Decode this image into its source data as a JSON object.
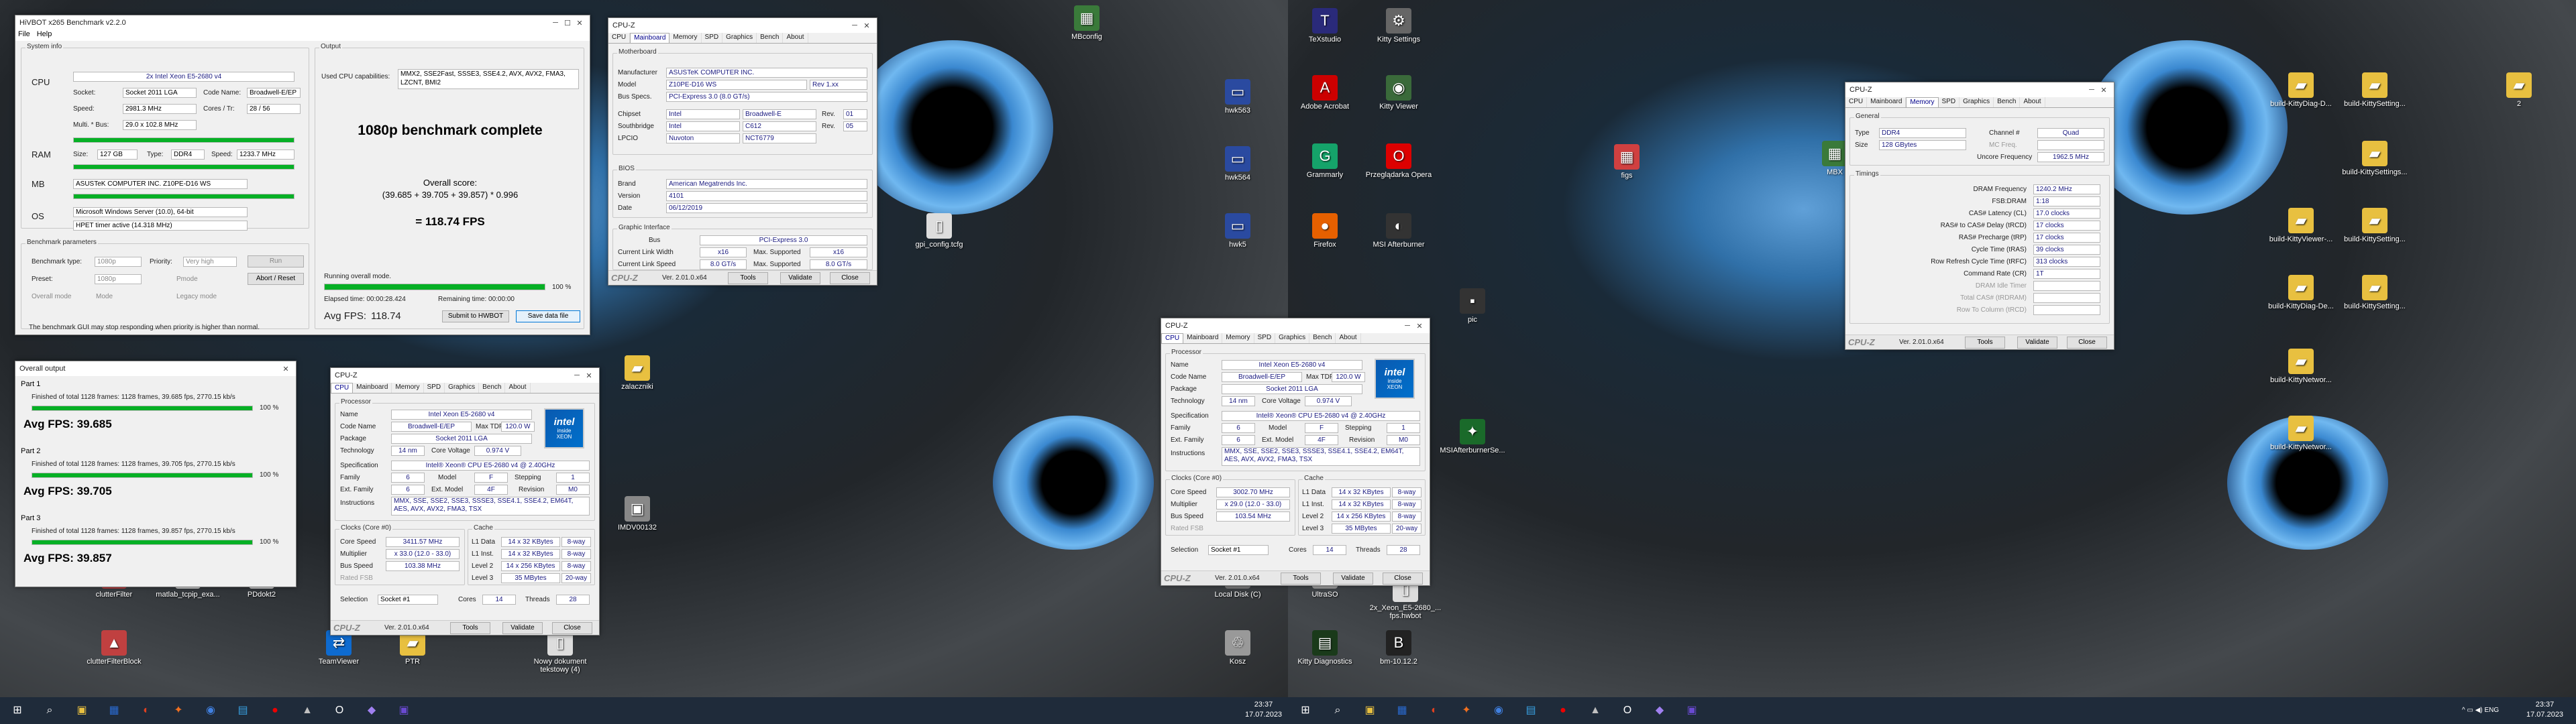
{
  "hivbot": {
    "title": "HiVBOT x265 Benchmark v2.2.0",
    "menu": [
      "File",
      "Help"
    ],
    "system_info_label": "System info",
    "cpu_label": "CPU",
    "ram_label": "RAM",
    "mb_label": "MB",
    "os_label": "OS",
    "cpu_name": "2x Intel Xeon E5-2680 v4",
    "socket_label": "Socket:",
    "socket": "Socket 2011 LGA",
    "codename_label": "Code Name:",
    "codename": "Broadwell-E/EP",
    "speed_label": "Speed:",
    "speed": "2981.3 MHz",
    "cores_label": "Cores / Tr:",
    "cores": "28 / 56",
    "multbus_label": "Multi. * Bus:",
    "multbus": "29.0 x 102.8 MHz",
    "ram_size_label": "Size:",
    "ram_size": "127 GB",
    "ram_type_label": "Type:",
    "ram_type": "DDR4",
    "ram_speed_label": "Speed:",
    "ram_speed": "1233.7 MHz",
    "mb_name": "ASUSTeK COMPUTER INC. Z10PE-D16 WS",
    "os_name": "Microsoft Windows Server (10.0), 64-bit",
    "timer": "HPET timer active (14.318 MHz)",
    "output_label": "Output",
    "caps_label": "Used CPU capabilities:",
    "caps": "MMX2, SSE2Fast, SSSE3, SSE4.2, AVX, AVX2, FMA3, LZCNT, BMI2",
    "complete": "1080p benchmark complete",
    "overall_label": "Overall score:",
    "formula": "(39.685 + 39.705 + 39.857) * 0.996",
    "result": "= 118.74 FPS",
    "params_label": "Benchmark parameters",
    "btype_label": "Benchmark type:",
    "btype": "1080p",
    "priority_label": "Priority:",
    "priority": "Very high",
    "run_label": "Run",
    "preset_label": "Preset:",
    "preset": "1080p",
    "pmode_label": "Pmode",
    "abort_label": "Abort / Reset",
    "overall_mode_label": "Overall mode",
    "mode_label": "Mode",
    "legacy_label": "Legacy mode",
    "status_text": "Running overall mode.",
    "progress_pct": "100 %",
    "progress_value": 100,
    "elapsed": "Elapsed time: 00:00:28.424",
    "remaining": "Remaining time: 00:00:00",
    "avgfps_label": "Avg FPS:",
    "avgfps": "118.74",
    "submit_label": "Submit to HWBOT",
    "save_label": "Save data file",
    "warning": "The benchmark GUI may stop responding when priority is higher than normal."
  },
  "overall": {
    "title": "Overall output",
    "parts": [
      {
        "label": "Part 1",
        "line": "Finished of total 1128 frames: 1128 frames, 39.685 fps, 2770.15 kb/s",
        "pct": "100 %",
        "avg": "Avg FPS: 39.685"
      },
      {
        "label": "Part 2",
        "line": "Finished of total 1128 frames: 1128 frames, 39.705 fps, 2770.15 kb/s",
        "pct": "100 %",
        "avg": "Avg FPS: 39.705"
      },
      {
        "label": "Part 3",
        "line": "Finished of total 1128 frames: 1128 frames, 39.857 fps, 2770.15 kb/s",
        "pct": "100 %",
        "avg": "Avg FPS: 39.857"
      }
    ]
  },
  "cpuz_mb": {
    "title": "CPU-Z",
    "tabs": [
      "CPU",
      "Mainboard",
      "Memory",
      "SPD",
      "Graphics",
      "Bench",
      "About"
    ],
    "mb_label": "Motherboard",
    "manufacturer_label": "Manufacturer",
    "manufacturer": "ASUSTeK COMPUTER INC.",
    "model_label": "Model",
    "model": "Z10PE-D16 WS",
    "rev": "Rev 1.xx",
    "busspecs_label": "Bus Specs.",
    "busspecs": "PCI-Express 3.0 (8.0 GT/s)",
    "chipset_label": "Chipset",
    "chipset": "Intel",
    "chipset2": "Broadwell-E",
    "rev_label": "Rev.",
    "chipset_rev": "01",
    "southbridge_label": "Southbridge",
    "southbridge": "Intel",
    "southbridge2": "C612",
    "sb_rev": "05",
    "lpcio_label": "LPCIO",
    "lpcio": "Nuvoton",
    "lpcio2": "NCT6779",
    "bios_label": "BIOS",
    "brand_label": "Brand",
    "brand": "American Megatrends Inc.",
    "version_label": "Version",
    "version": "4101",
    "date_label": "Date",
    "date": "06/12/2019",
    "gi_label": "Graphic Interface",
    "bus_label": "Bus",
    "bus": "PCI-Express 3.0",
    "clw_label": "Current Link Width",
    "clw": "x16",
    "msw_label": "Max. Supported",
    "msw": "x16",
    "cls_label": "Current Link Speed",
    "cls": "8.0 GT/s",
    "mss": "8.0 GT/s",
    "ver": "Ver. 2.01.0.x64",
    "tools": "Tools",
    "validate": "Validate",
    "close": "Close"
  },
  "cpuz_cpu": {
    "title": "CPU-Z",
    "tabs": [
      "CPU",
      "Mainboard",
      "Memory",
      "SPD",
      "Graphics",
      "Bench",
      "About"
    ],
    "processor_label": "Processor",
    "name_label": "Name",
    "name": "Intel Xeon E5-2680 v4",
    "codename_label": "Code Name",
    "codename": "Broadwell-E/EP",
    "maxtdp_label": "Max TDP",
    "maxtdp": "120.0 W",
    "package_label": "Package",
    "package": "Socket 2011 LGA",
    "tech_label": "Technology",
    "tech": "14 nm",
    "cv_label": "Core Voltage",
    "cv": "0.974 V",
    "spec_label": "Specification",
    "spec": "Intel® Xeon® CPU E5-2680 v4 @ 2.40GHz",
    "family_label": "Family",
    "family": "6",
    "model_label": "Model",
    "model": "F",
    "stepping_label": "Stepping",
    "stepping": "1",
    "extfam_label": "Ext. Family",
    "extfam": "6",
    "extmodel_label": "Ext. Model",
    "extmodel": "4F",
    "revision_label": "Revision",
    "revision": "M0",
    "instr_label": "Instructions",
    "instr": "MMX, SSE, SSE2, SSE3, SSSE3, SSE4.1, SSE4.2, EM64T, AES, AVX, AVX2, FMA3, TSX",
    "clocks_label": "Clocks (Core #0)",
    "cache_label": "Cache",
    "cs_label": "Core Speed",
    "mult_label": "Multiplier",
    "bus_label": "Bus Speed",
    "fsb_label": "Rated FSB",
    "l1d_label": "L1 Data",
    "l1d": "14 x 32 KBytes",
    "l1d_w": "8-way",
    "l1i_label": "L1 Inst.",
    "l1i": "14 x 32 KBytes",
    "l1i_w": "8-way",
    "l2_label": "Level 2",
    "l2": "14 x 256 KBytes",
    "l2_w": "8-way",
    "l3_label": "Level 3",
    "l3": "35 MBytes",
    "l3_w": "20-way",
    "sel_label": "Selection",
    "sel": "Socket #1",
    "cores_label": "Cores",
    "cores": "14",
    "threads_label": "Threads",
    "threads": "28",
    "ver": "Ver. 2.01.0.x64",
    "tools": "Tools",
    "validate": "Validate",
    "close": "Close",
    "a_cs": "3411.57 MHz",
    "a_mult": "x 33.0 (12.0 - 33.0)",
    "a_bus": "103.38 MHz",
    "b_cs": "3002.70 MHz",
    "b_mult": "x 29.0 (12.0 - 33.0)",
    "b_bus": "103.54 MHz"
  },
  "cpuz_mem": {
    "title": "CPU-Z",
    "tabs": [
      "CPU",
      "Mainboard",
      "Memory",
      "SPD",
      "Graphics",
      "Bench",
      "About"
    ],
    "general_label": "General",
    "type_label": "Type",
    "type": "DDR4",
    "channel_label": "Channel #",
    "channel": "Quad",
    "memctrl_label": "MC Freq.",
    "size_label": "Size",
    "size": "128 GBytes",
    "uncore_label": "Uncore Frequency",
    "uncore": "1962.5 MHz",
    "timings_label": "Timings",
    "rows": [
      {
        "l": "DRAM Frequency",
        "v": "1240.2 MHz"
      },
      {
        "l": "FSB:DRAM",
        "v": "1:18"
      },
      {
        "l": "CAS# Latency (CL)",
        "v": "17.0 clocks"
      },
      {
        "l": "RAS# to CAS# Delay (tRCD)",
        "v": "17 clocks"
      },
      {
        "l": "RAS# Precharge (tRP)",
        "v": "17 clocks"
      },
      {
        "l": "Cycle Time (tRAS)",
        "v": "39 clocks"
      },
      {
        "l": "Row Refresh Cycle Time (tRFC)",
        "v": "313 clocks"
      },
      {
        "l": "Command Rate (CR)",
        "v": "1T"
      },
      {
        "l": "DRAM Idle Timer",
        "v": ""
      },
      {
        "l": "Total CAS# (tRDRAM)",
        "v": ""
      },
      {
        "l": "Row To Column (tRCD)",
        "v": ""
      }
    ],
    "ver": "Ver. 2.01.0.x64",
    "tools": "Tools",
    "validate": "Validate",
    "close": "Close"
  },
  "icons_mid": [
    {
      "label": "MBconfig",
      "glyph": "▦",
      "color": "#3a7a3a"
    },
    {
      "label": "TeXstudio",
      "glyph": "T",
      "color": "#2a2a7a"
    },
    {
      "label": "Kitty Settings",
      "glyph": "⚙",
      "color": "#666"
    },
    {
      "label": "hwk563",
      "glyph": "▭",
      "color": "#2a4aa0"
    },
    {
      "label": "Adobe Acrobat",
      "glyph": "A",
      "color": "#c00"
    },
    {
      "label": "Kitty Viewer",
      "glyph": "◉",
      "color": "#3a6a3a"
    },
    {
      "label": "hwk564",
      "glyph": "▭",
      "color": "#2a4aa0"
    },
    {
      "label": "Grammarly",
      "glyph": "G",
      "color": "#15a36a"
    },
    {
      "label": "Przeglądarka Opera",
      "glyph": "O",
      "color": "#d00"
    },
    {
      "label": "hwk5",
      "glyph": "▭",
      "color": "#2a4aa0"
    },
    {
      "label": "Firefox",
      "glyph": "●",
      "color": "#e66000"
    },
    {
      "label": "MSI Afterburner",
      "glyph": "◐",
      "color": "#333"
    },
    {
      "label": "gpi_config.tcfg",
      "glyph": "▯",
      "color": "#ddd"
    },
    {
      "label": "zalaczniki",
      "glyph": "▰",
      "color": "#e8c040"
    },
    {
      "label": "IMDV00132",
      "glyph": "▣",
      "color": "#888"
    },
    {
      "label": "MSIAfterburnerSe...",
      "glyph": "✦",
      "color": "#1a6a2a"
    },
    {
      "label": "pic",
      "glyph": "▪",
      "color": "#333"
    },
    {
      "label": "figs",
      "glyph": "▦",
      "color": "#d04040"
    },
    {
      "label": "Local Disk (C)",
      "glyph": "▤",
      "color": "#777"
    },
    {
      "label": "UltraSO",
      "glyph": "◎",
      "color": "#999"
    },
    {
      "label": "2x_Xeon_E5-2680_... fps.hwbot",
      "glyph": "▯",
      "color": "#ddd"
    },
    {
      "label": "Kosz",
      "glyph": "♲",
      "color": "#999"
    },
    {
      "label": "Kitty Diagnostics",
      "glyph": "▤",
      "color": "#1a3a1a"
    },
    {
      "label": "bm-10.12.2",
      "glyph": "B",
      "color": "#222"
    },
    {
      "label": "clutterFilter",
      "glyph": "▲",
      "color": "#c04040"
    },
    {
      "label": "matlab_tcpip_exa...",
      "glyph": "▯",
      "color": "#ddd"
    },
    {
      "label": "PDdokt2",
      "glyph": "▯",
      "color": "#ddd"
    },
    {
      "label": "clutterFilterBlock",
      "glyph": "▲",
      "color": "#c04040"
    },
    {
      "label": "TeamViewer",
      "glyph": "⇄",
      "color": "#0e6bd0"
    },
    {
      "label": "PTR",
      "glyph": "▰",
      "color": "#e8c040"
    },
    {
      "label": "Nowy dokument tekstowy (4)",
      "glyph": "▯",
      "color": "#ddd"
    }
  ],
  "icons_right": [
    {
      "label": "build-KittyDiag-D...",
      "glyph": "▰",
      "color": "#e8c040"
    },
    {
      "label": "build-KittySetting...",
      "glyph": "▰",
      "color": "#e8c040"
    },
    {
      "label": "2",
      "glyph": "▰",
      "color": "#e8c040"
    },
    {
      "label": "build-KittySettings...",
      "glyph": "▰",
      "color": "#e8c040"
    },
    {
      "label": "build-KittyViewer-...",
      "glyph": "▰",
      "color": "#e8c040"
    },
    {
      "label": "build-KittySetting...",
      "glyph": "▰",
      "color": "#e8c040"
    },
    {
      "label": "build-KittyDiag-De...",
      "glyph": "▰",
      "color": "#e8c040"
    },
    {
      "label": "build-KittySetting...",
      "glyph": "▰",
      "color": "#e8c040"
    },
    {
      "label": "build-KittyNetwor...",
      "glyph": "▰",
      "color": "#e8c040"
    },
    {
      "label": "build-KittyNetwor...",
      "glyph": "▰",
      "color": "#e8c040"
    },
    {
      "label": "MBX",
      "glyph": "▦",
      "color": "#3a7a3a"
    }
  ],
  "taskbar": {
    "time1": "23:37",
    "date1": "17.07.2023",
    "time2": "23:37",
    "date2": "17.07.2023",
    "apps": [
      "⊞",
      "⌕",
      "▣",
      "▦",
      "◐",
      "✦",
      "◉",
      "▤",
      "●",
      "▲",
      "O",
      "◆",
      "▣"
    ],
    "tray": "^ ▭ ◀) ENG"
  }
}
